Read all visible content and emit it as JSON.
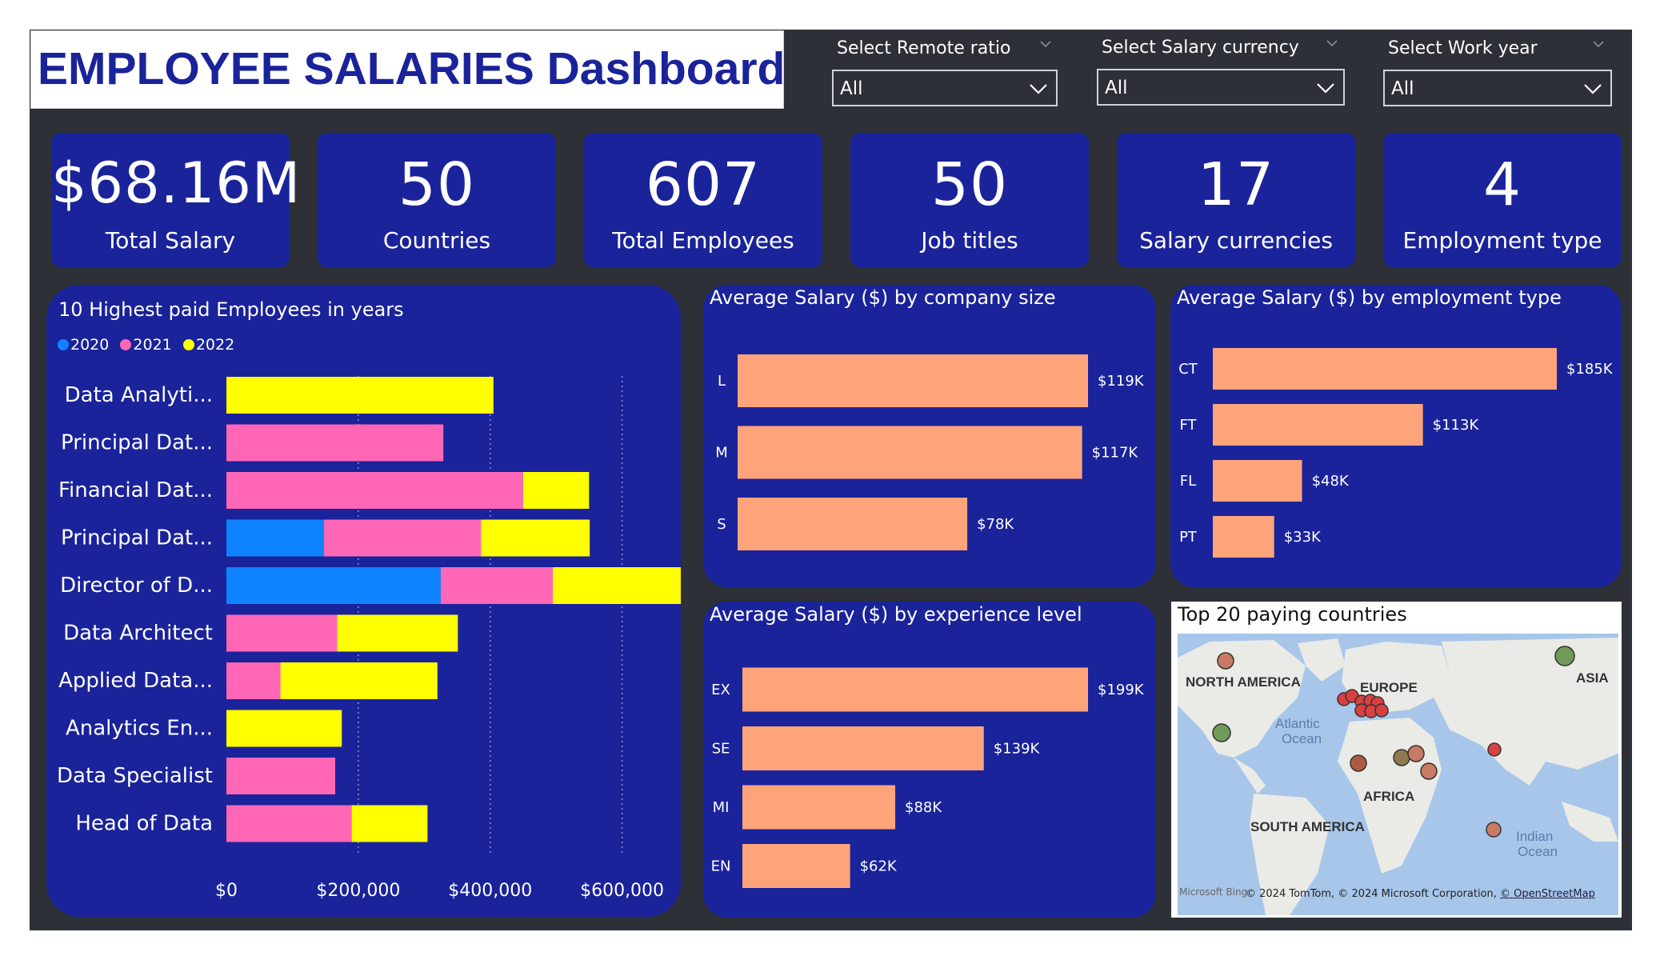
{
  "title": "EMPLOYEE SALARIES Dashboard",
  "filters": [
    {
      "label": "Select Remote ratio",
      "value": "All"
    },
    {
      "label": "Select Salary currency",
      "value": "All"
    },
    {
      "label": "Select Work year",
      "value": "All"
    }
  ],
  "kpis": [
    {
      "value": "$68.16M",
      "caption": "Total Salary"
    },
    {
      "value": "50",
      "caption": "Countries"
    },
    {
      "value": "607",
      "caption": "Total Employees"
    },
    {
      "value": "50",
      "caption": "Job titles"
    },
    {
      "value": "17",
      "caption": "Salary currencies"
    },
    {
      "value": "4",
      "caption": "Employment type"
    }
  ],
  "colors": {
    "blue": "#0f83ff",
    "pink": "#ff67b6",
    "yellow": "#ffff00",
    "salmon": "#ffa47a",
    "panel": "#1a239a"
  },
  "chart_data": [
    {
      "type": "bar",
      "orientation": "horizontal",
      "stacked": true,
      "title": "10 Highest paid Employees in years",
      "legend_position": "top-left",
      "categories": [
        "Data Analyti...",
        "Principal Dat...",
        "Financial Dat...",
        "Principal Dat...",
        "Director of D...",
        "Data Architect",
        "Applied Data...",
        "Analytics En...",
        "Data Specialist",
        "Head of Data"
      ],
      "series": [
        {
          "name": "2020",
          "color": "#0f83ff",
          "values": [
            0,
            0,
            0,
            148000,
            325000,
            0,
            0,
            0,
            0,
            0
          ]
        },
        {
          "name": "2021",
          "color": "#ff67b6",
          "values": [
            0,
            329000,
            450000,
            238000,
            170000,
            168000,
            82000,
            0,
            165000,
            190000
          ]
        },
        {
          "name": "2022",
          "color": "#ffff00",
          "values": [
            405000,
            0,
            100000,
            165000,
            197000,
            183000,
            238000,
            175000,
            0,
            115000
          ]
        }
      ],
      "xlim": [
        0,
        700000
      ],
      "ticks": [
        "$0",
        "$200,000",
        "$400,000",
        "$600,000"
      ],
      "grid": true
    },
    {
      "type": "bar",
      "orientation": "horizontal",
      "title": "Average Salary ($) by company size",
      "categories": [
        "L",
        "M",
        "S"
      ],
      "values": [
        119000,
        117000,
        78000
      ],
      "labels": [
        "$119K",
        "$117K",
        "$78K"
      ],
      "xlim": [
        0,
        119000
      ]
    },
    {
      "type": "bar",
      "orientation": "horizontal",
      "title": "Average Salary ($) by employment type",
      "categories": [
        "CT",
        "FT",
        "FL",
        "PT"
      ],
      "values": [
        185000,
        113000,
        48000,
        33000
      ],
      "labels": [
        "$185K",
        "$113K",
        "$48K",
        "$33K"
      ],
      "xlim": [
        0,
        185000
      ]
    },
    {
      "type": "bar",
      "orientation": "horizontal",
      "title": "Average Salary ($) by experience level",
      "categories": [
        "EX",
        "SE",
        "MI",
        "EN"
      ],
      "values": [
        199000,
        139000,
        88000,
        62000
      ],
      "labels": [
        "$199K",
        "$139K",
        "$88K",
        "$62K"
      ],
      "xlim": [
        0,
        199000
      ]
    }
  ],
  "map": {
    "title": "Top 20 paying countries",
    "labels": [
      "NORTH AMERICA",
      "EUROPE",
      "ASIA",
      "AFRICA",
      "SOUTH AMERICA",
      "Atlantic",
      "Ocean",
      "Indian",
      "Ocean"
    ],
    "brand": "Microsoft Bing",
    "credit": "© 2024 TomTom, © 2024 Microsoft Corporation,",
    "credit_link": "© OpenStreetMap"
  }
}
